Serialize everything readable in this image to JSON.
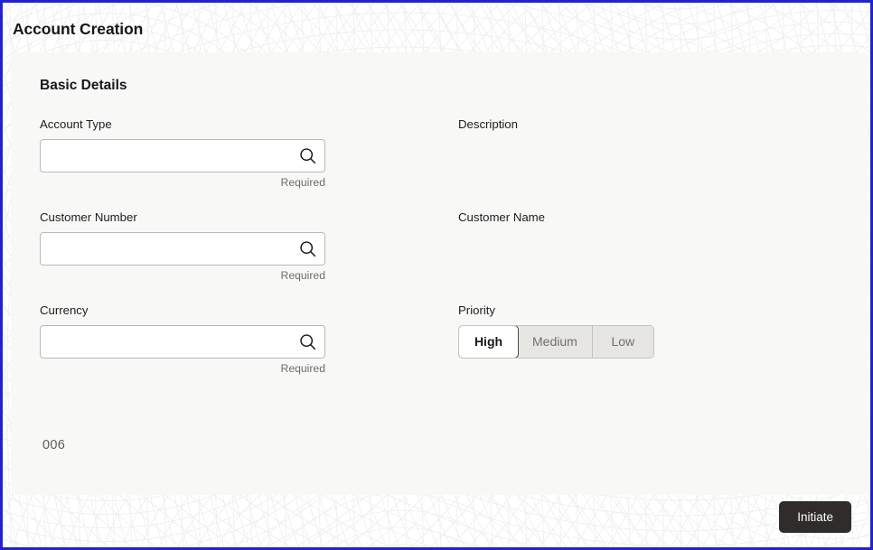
{
  "window": {
    "title": "Account Creation",
    "accent_border_color": "#2222cc",
    "card_bg_color": "#f8f8f6"
  },
  "section": {
    "title": "Basic Details"
  },
  "fields": {
    "account_type": {
      "label": "Account Type",
      "value": "",
      "placeholder": "",
      "helper": "Required",
      "icon": "search-icon"
    },
    "description": {
      "label": "Description",
      "value": ""
    },
    "customer_number": {
      "label": "Customer Number",
      "value": "",
      "placeholder": "",
      "helper": "Required",
      "icon": "search-icon"
    },
    "customer_name": {
      "label": "Customer Name",
      "value": ""
    },
    "currency": {
      "label": "Currency",
      "value": "",
      "placeholder": "",
      "helper": "Required",
      "icon": "search-icon"
    },
    "priority": {
      "label": "Priority",
      "options": [
        "High",
        "Medium",
        "Low"
      ],
      "selected": "High"
    }
  },
  "note": "006",
  "actions": {
    "initiate_label": "Initiate"
  }
}
